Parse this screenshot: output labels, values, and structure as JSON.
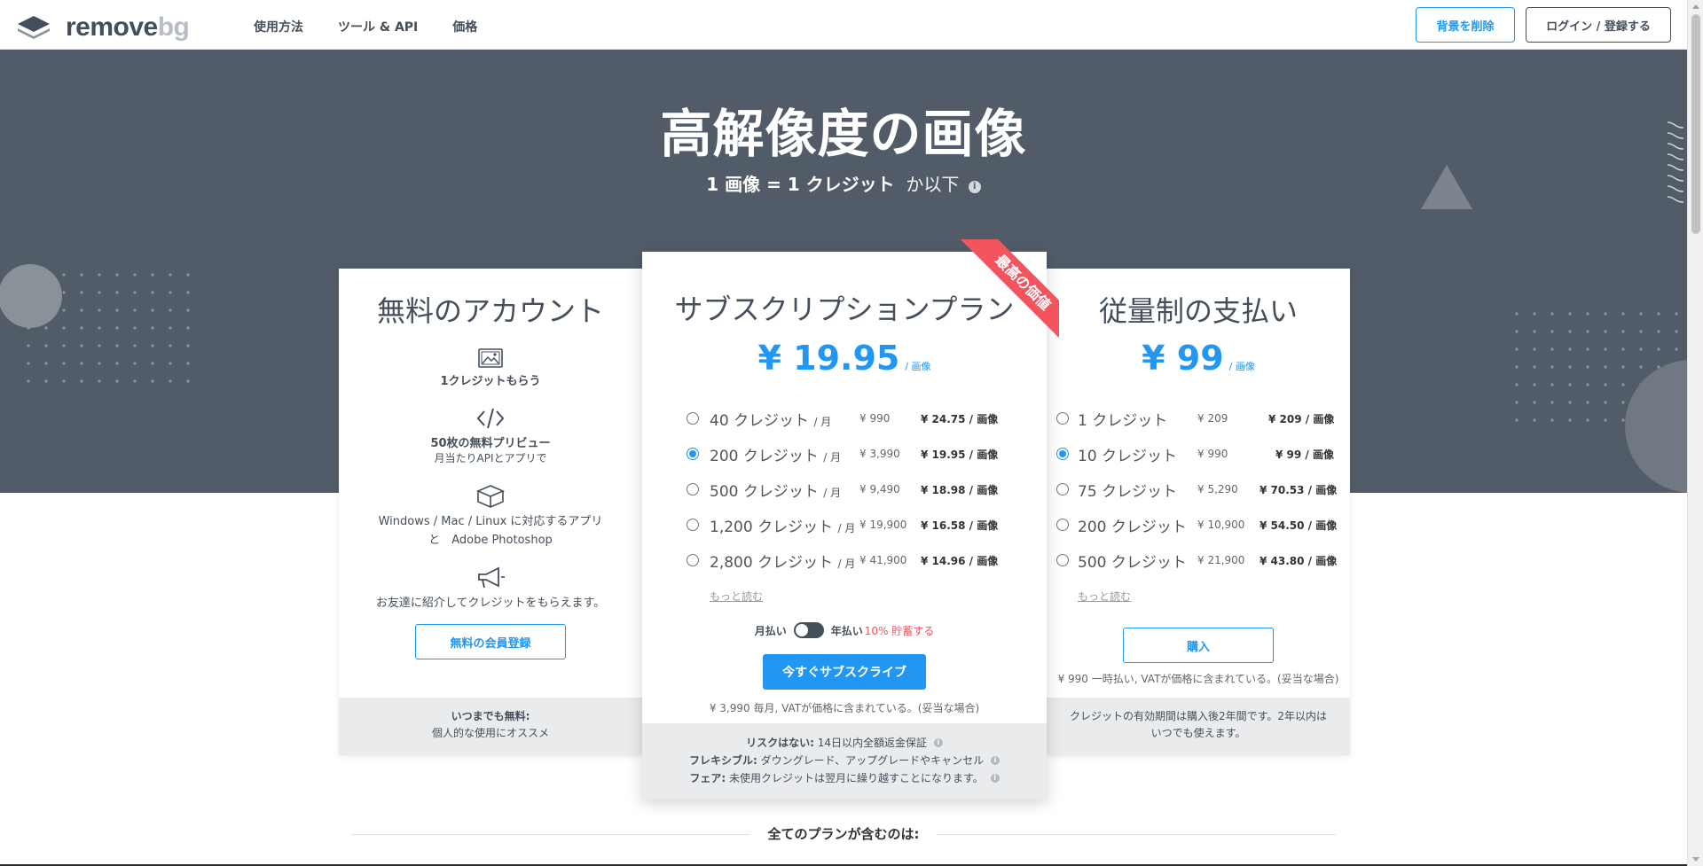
{
  "header": {
    "logo": {
      "text_main": "remove",
      "text_bg": "bg"
    },
    "nav": [
      "使用方法",
      "ツール & API",
      "価格"
    ],
    "remove_bg_button": "背景を削除",
    "login_button": "ログイン / 登録する"
  },
  "hero": {
    "title": "高解像度の画像",
    "subtitle_bold": "1 画像 = 1 クレジット",
    "subtitle_light": "か以下",
    "info_glyph": "i"
  },
  "free_card": {
    "title": "無料のアカウント",
    "features": [
      {
        "icon": "image-icon",
        "bold": "1クレジットもらう"
      },
      {
        "icon": "code-icon",
        "bold": "50枚の無料プリビュー",
        "small": "月当たりAPIとアプリで"
      },
      {
        "icon": "box-icon",
        "line1": "Windows / Mac / Linux に対応するアプリ",
        "line2": "と　Adobe Photoshop"
      },
      {
        "icon": "megaphone-icon",
        "line1": "お友達に紹介してクレジットをもらえます。"
      }
    ],
    "signup_button": "無料の会員登録",
    "footer_bold": "いつまでも無料:",
    "footer_text": "個人的な使用にオススメ"
  },
  "subscription_card": {
    "title": "サブスクリプションプラン",
    "ribbon": "最高の価値",
    "price": "¥ 19.95",
    "price_unit": "/ 画像",
    "options": [
      {
        "credits": "40 クレジット",
        "period": "/ 月",
        "yen": "¥ 990",
        "per_image": "¥ 24.75 / 画像",
        "selected": false
      },
      {
        "credits": "200 クレジット",
        "period": "/ 月",
        "yen": "¥ 3,990",
        "per_image": "¥ 19.95 / 画像",
        "selected": true
      },
      {
        "credits": "500 クレジット",
        "period": "/ 月",
        "yen": "¥ 9,490",
        "per_image": "¥ 18.98 / 画像",
        "selected": false
      },
      {
        "credits": "1,200 クレジット",
        "period": "/ 月",
        "yen": "¥ 19,900",
        "per_image": "¥ 16.58 / 画像",
        "selected": false
      },
      {
        "credits": "2,800 クレジット",
        "period": "/ 月",
        "yen": "¥ 41,900",
        "per_image": "¥ 14.96 / 画像",
        "selected": false
      }
    ],
    "more_link": "もっと読む",
    "toggle_monthly": "月払い",
    "toggle_yearly": "年払い",
    "toggle_save": "10% 貯蓄する",
    "subscribe_button": "今すぐサブスクライブ",
    "note": "¥ 3,990 毎月, VATが価格に含まれている。(妥当な場合)",
    "footer": [
      {
        "bold": "リスクはない:",
        "text": "14日以内全額返金保証"
      },
      {
        "bold": "フレキシブル:",
        "text": "ダウングレード、アップグレードやキャンセル"
      },
      {
        "bold": "フェア:",
        "text": "未使用クレジットは翌月に繰り越すことになります。"
      }
    ]
  },
  "payg_card": {
    "title": "従量制の支払い",
    "price": "¥ 99",
    "price_unit": "/ 画像",
    "options": [
      {
        "credits": "1 クレジット",
        "yen": "¥ 209",
        "per_image": "¥ 209 / 画像",
        "selected": false
      },
      {
        "credits": "10 クレジット",
        "yen": "¥ 990",
        "per_image": "¥ 99 / 画像",
        "selected": true
      },
      {
        "credits": "75 クレジット",
        "yen": "¥ 5,290",
        "per_image": "¥ 70.53 / 画像",
        "selected": false
      },
      {
        "credits": "200 クレジット",
        "yen": "¥ 10,900",
        "per_image": "¥ 54.50 / 画像",
        "selected": false
      },
      {
        "credits": "500 クレジット",
        "yen": "¥ 21,900",
        "per_image": "¥ 43.80 / 画像",
        "selected": false
      }
    ],
    "more_link": "もっと読む",
    "buy_button": "購入",
    "note": "¥ 990 一時払い, VATが価格に含まれている。(妥当な場合)",
    "footer_line1": "クレジットの有効期間は購入後2年間です。2年以内は",
    "footer_line2": "いつでも使えます。"
  },
  "all_plans_heading": "全てのプランが含むのは:",
  "colors": {
    "accent": "#2196f3",
    "hero_bg": "#525c68",
    "ribbon": "#f4545e",
    "text": "#454f5b"
  }
}
